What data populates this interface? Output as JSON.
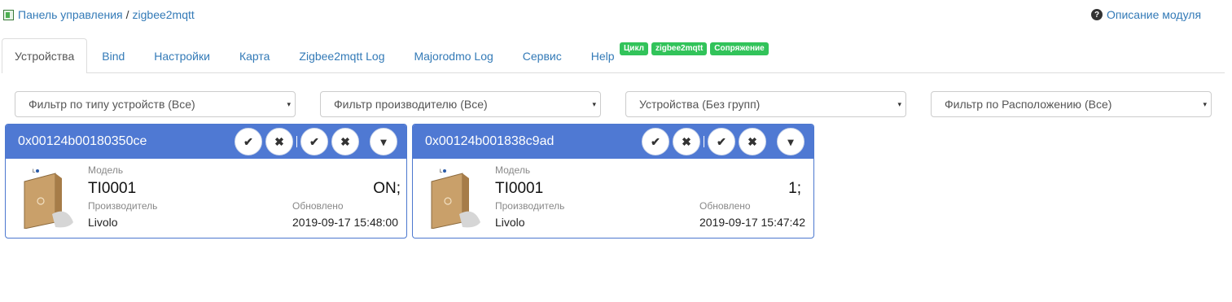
{
  "breadcrumb": {
    "root": "Панель управления",
    "separator": "/",
    "current": "zigbee2mqtt"
  },
  "help_link": "Описание модуля",
  "tabs": [
    {
      "label": "Устройства",
      "active": true
    },
    {
      "label": "Bind"
    },
    {
      "label": "Настройки"
    },
    {
      "label": "Карта"
    },
    {
      "label": "Zigbee2mqtt Log"
    },
    {
      "label": "Majorodmo Log"
    },
    {
      "label": "Сервис"
    },
    {
      "label": "Help"
    }
  ],
  "status_badges": [
    "Цикл",
    "zigbee2mqtt",
    "Сопряжение"
  ],
  "badge_color": "#32c35a",
  "filters": [
    {
      "selected": "Фильтр по типу устройств (Все)"
    },
    {
      "selected": "Фильтр производителю (Все)"
    },
    {
      "selected": "Устройства (Без групп)"
    },
    {
      "selected": "Фильтр по Расположению (Все)"
    }
  ],
  "devices": [
    {
      "id": "0x00124b00180350ce",
      "model_label": "Модель",
      "model": "TI0001",
      "state": "ON;",
      "vendor_label": "Производитель",
      "vendor": "Livolo",
      "updated_label": "Обновлено",
      "updated": "2019-09-17 15:48:00"
    },
    {
      "id": "0x00124b001838c9ad",
      "model_label": "Модель",
      "model": "TI0001",
      "state": "1;",
      "vendor_label": "Производитель",
      "vendor": "Livolo",
      "updated_label": "Обновлено",
      "updated": "2019-09-17 15:47:42"
    }
  ],
  "icons": {
    "check": "✔",
    "close": "✖",
    "dropdown": "▾"
  },
  "header_color": "#4f79d3"
}
